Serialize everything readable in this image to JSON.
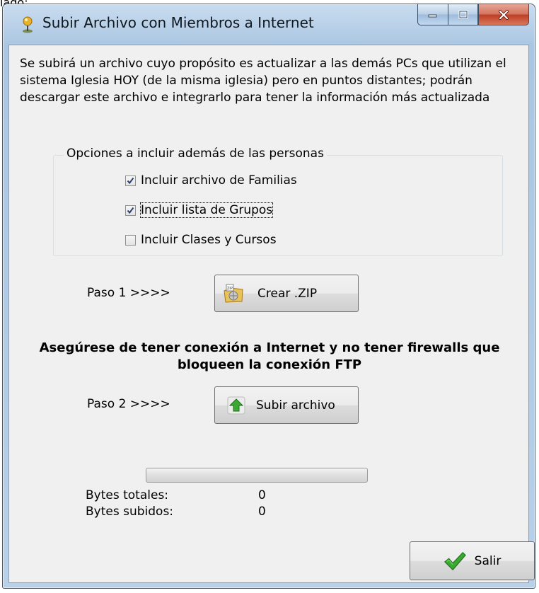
{
  "stray_text": "lado:",
  "window": {
    "title": "Subir Archivo con Miembros a Internet",
    "icon": "app-pin-icon"
  },
  "description": "Se subirá un archivo cuyo propósito es actualizar a las demás PCs que utilizan el sistema Iglesia HOY (de la misma iglesia) pero en puntos distantes; podrán descargar este archivo e integrarlo para tener la información más actualizada",
  "options": {
    "legend": "Opciones a incluir además de las personas",
    "items": [
      {
        "label": "Incluir archivo de Familias",
        "checked": true
      },
      {
        "label": "Incluir lista de Grupos",
        "checked": true
      },
      {
        "label": "Incluir Clases y Cursos",
        "checked": false
      }
    ]
  },
  "step1": {
    "label": "Paso 1 >>>>",
    "button": "Crear .ZIP",
    "icon": "zip-folder-icon"
  },
  "warning": "Asegúrese de tener conexión a Internet y no tener firewalls que bloqueen la conexión FTP",
  "step2": {
    "label": "Paso 2 >>>>",
    "button": "Subir archivo",
    "icon": "upload-arrow-icon"
  },
  "progress": {
    "fraction": 0
  },
  "stats": {
    "total_label": "Bytes totales:",
    "total_value": "0",
    "sent_label": "Bytes subidos:",
    "sent_value": "0"
  },
  "exit_button": {
    "label": "Salir",
    "icon": "checkmark-icon"
  },
  "colors": {
    "accent_green": "#3aa832",
    "close_red": "#c4412a"
  }
}
